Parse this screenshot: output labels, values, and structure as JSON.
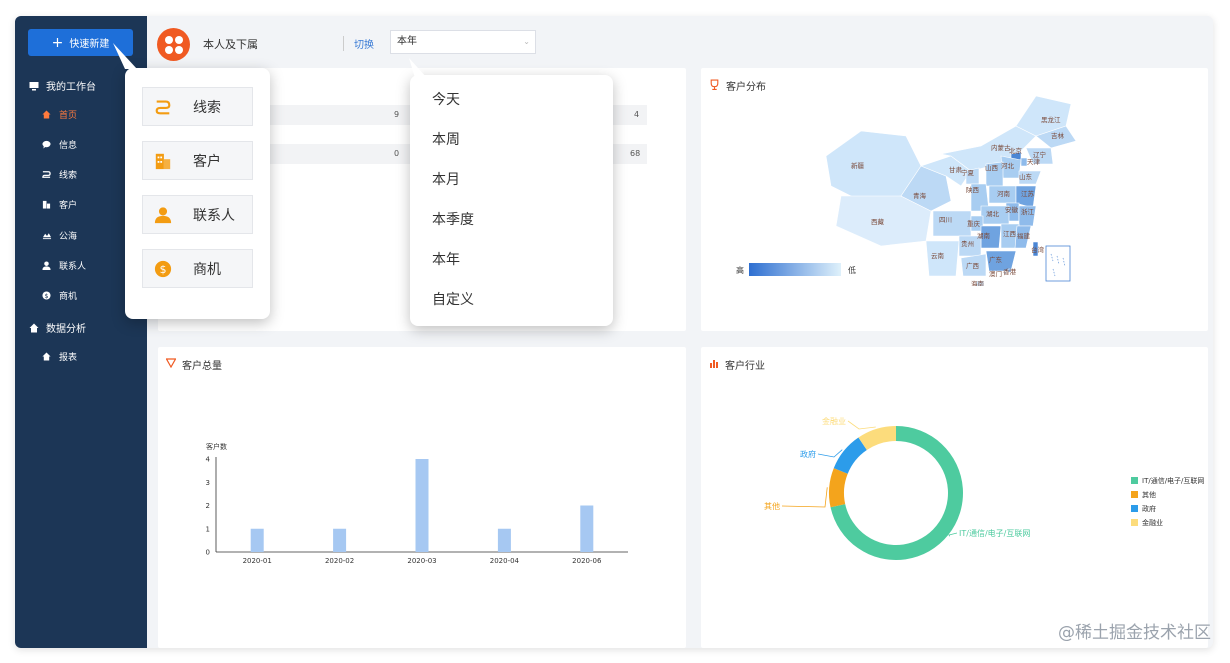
{
  "sidebar": {
    "quick_new": "快速新建",
    "sections": [
      {
        "label": "我的工作台",
        "icon": "monitor-icon"
      },
      {
        "label": "数据分析",
        "icon": "home-icon"
      }
    ],
    "items": [
      {
        "label": "首页",
        "icon": "home-icon",
        "active": true
      },
      {
        "label": "信息",
        "icon": "chat-bubble-icon"
      },
      {
        "label": "线索",
        "icon": "lead-icon"
      },
      {
        "label": "客户",
        "icon": "building-icon"
      },
      {
        "label": "公海",
        "icon": "sea-icon"
      },
      {
        "label": "联系人",
        "icon": "person-icon"
      },
      {
        "label": "商机",
        "icon": "dollar-icon"
      },
      {
        "label": "报表",
        "icon": "home-icon"
      }
    ]
  },
  "topbar": {
    "scope": "本人及下属",
    "switch": "切换",
    "period_selected": "本年"
  },
  "quick_new_menu": [
    {
      "label": "线索",
      "icon": "lead-icon"
    },
    {
      "label": "客户",
      "icon": "building-icon"
    },
    {
      "label": "联系人",
      "icon": "person-icon"
    },
    {
      "label": "商机",
      "icon": "dollar-icon"
    }
  ],
  "period_menu": [
    "今天",
    "本周",
    "本月",
    "本季度",
    "本年",
    "自定义"
  ],
  "stats": {
    "rows": [
      {
        "left": "9",
        "right": "4"
      },
      {
        "left": "0",
        "right": "68"
      }
    ]
  },
  "distribution": {
    "title": "客户分布",
    "legend_high": "高",
    "legend_low": "低",
    "provinces": [
      "新疆",
      "西藏",
      "青海",
      "甘肃",
      "内蒙古",
      "黑龙江",
      "吉林",
      "辽宁",
      "北京",
      "天津",
      "河北",
      "山西",
      "山东",
      "宁夏",
      "陕西",
      "河南",
      "江苏",
      "安徽",
      "湖北",
      "四川",
      "重庆",
      "浙江",
      "湖南",
      "江西",
      "贵州",
      "云南",
      "福建",
      "广西",
      "广东",
      "台湾",
      "海南",
      "香港",
      "澳门"
    ]
  },
  "total": {
    "title": "客户总量",
    "chart_data": {
      "type": "bar",
      "ylabel": "客户数",
      "categories": [
        "2020-01",
        "2020-02",
        "2020-03",
        "2020-04",
        "2020-06"
      ],
      "values": [
        1,
        1,
        4,
        1,
        2
      ],
      "ylim": [
        0,
        4
      ],
      "yticks": [
        "0",
        "1",
        "2",
        "3",
        "4"
      ],
      "color": "#a6c8f2"
    }
  },
  "industry": {
    "title": "客户行业",
    "chart_data": {
      "type": "pie",
      "donut": true,
      "slices": [
        {
          "label": "IT/通信/电子/互联网",
          "value": 68,
          "color": "#4ecb9f"
        },
        {
          "label": "其他",
          "value": 9,
          "color": "#f4a41c"
        },
        {
          "label": "政府",
          "value": 9,
          "color": "#2c9cea"
        },
        {
          "label": "金融业",
          "value": 9,
          "color": "#fcdc7c"
        }
      ],
      "legend_position": "right"
    }
  },
  "watermark": "@稀土掘金技术社区"
}
